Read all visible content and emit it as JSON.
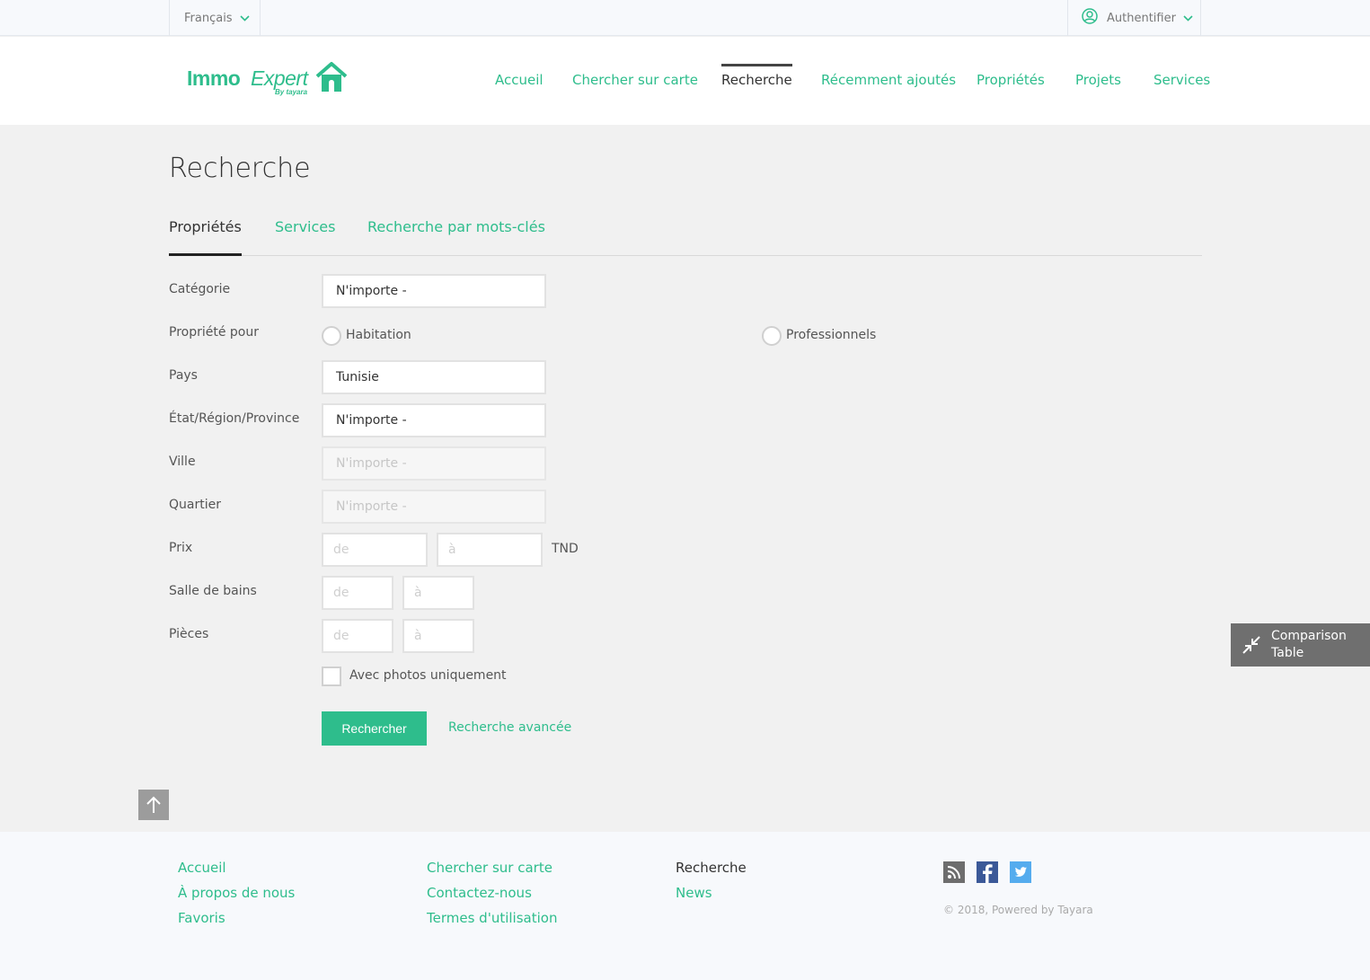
{
  "topbar": {
    "language": "Français",
    "auth": "Authentifier"
  },
  "header": {
    "logo_word1": "Immo",
    "logo_word2": "Expert",
    "logo_tagline": "By tayara",
    "nav": [
      "Accueil",
      "Chercher sur carte",
      "Recherche",
      "Récemment ajoutés",
      "Propriétés",
      "Projets",
      "Services"
    ],
    "active_nav": "Recherche"
  },
  "main": {
    "title": "Recherche",
    "tabs": [
      "Propriétés",
      "Services",
      "Recherche par mots-clés"
    ],
    "active_tab": "Propriétés",
    "form": {
      "categorie_label": "Catégorie",
      "categorie_value": "N'importe -",
      "propriete_pour_label": "Propriété pour",
      "radio_habitation": "Habitation",
      "radio_professionnels": "Professionnels",
      "pays_label": "Pays",
      "pays_value": "Tunisie",
      "etat_label": "État/Région/Province",
      "etat_value": "N'importe -",
      "ville_label": "Ville",
      "ville_value": "N'importe -",
      "quartier_label": "Quartier",
      "quartier_value": "N'importe -",
      "prix_label": "Prix",
      "prix_from_placeholder": "de",
      "prix_to_placeholder": "à",
      "prix_currency": "TND",
      "bains_label": "Salle de bains",
      "bains_from_placeholder": "de",
      "bains_to_placeholder": "à",
      "pieces_label": "Pièces",
      "pieces_from_placeholder": "de",
      "pieces_to_placeholder": "à",
      "photos_only_label": "Avec photos uniquement",
      "search_button": "Rechercher",
      "advanced_link": "Recherche avancée"
    },
    "comparison_table": "Comparison Table"
  },
  "footer": {
    "col1": [
      "Accueil",
      "À propos de nous",
      "Favoris"
    ],
    "col2": [
      "Chercher sur carte",
      "Contactez-nous",
      "Termes d'utilisation"
    ],
    "col3": [
      "Recherche",
      "News"
    ],
    "copyright": "© 2018, Powered by Tayara"
  },
  "colors": {
    "accent": "#2ebd8c",
    "comparison_bg": "#6f6f6f",
    "page_bg": "#f1f1f1"
  }
}
